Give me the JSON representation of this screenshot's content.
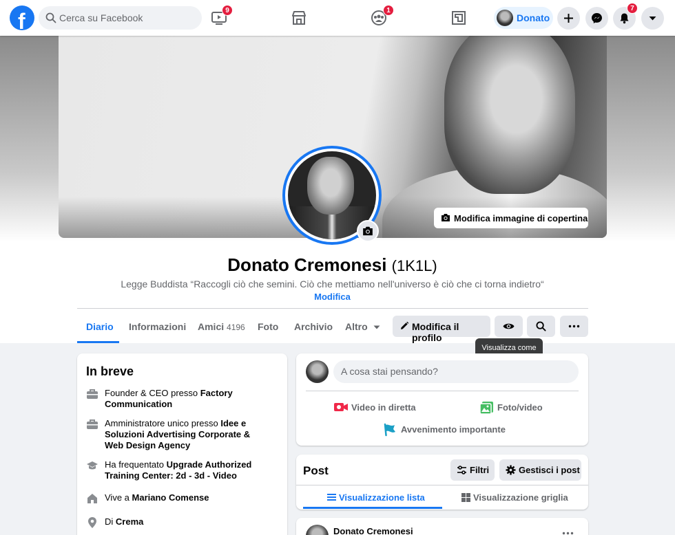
{
  "topbar": {
    "search_placeholder": "Cerca su Facebook",
    "watch_badge": "9",
    "groups_badge": "1",
    "profile_name": "Donato",
    "notifications_badge": "7"
  },
  "cover": {
    "edit_cover_label": "Modifica immagine di copertina"
  },
  "profile": {
    "name": "Donato Cremonesi",
    "alt_name": "(1K1L)",
    "bio": "Legge Buddista “Raccogli ciò che semini. Ciò che mettiamo nell'universo è ciò che ci torna indietro“",
    "bio_edit": "Modifica"
  },
  "tabs": {
    "diario": "Diario",
    "informazioni": "Informazioni",
    "amici": "Amici",
    "amici_count": "4196",
    "foto": "Foto",
    "archivio": "Archivio",
    "altro": "Altro",
    "edit_profile": "Modifica il profilo",
    "view_as_tooltip": "Visualizza come"
  },
  "intro": {
    "title": "In breve",
    "items": [
      {
        "prefix": "Founder & CEO presso ",
        "bold": "Factory Communication",
        "icon": "briefcase-icon"
      },
      {
        "prefix": "Amministratore unico presso ",
        "bold": "Idee e Soluzioni Advertising Corporate & Web Design Agency",
        "icon": "briefcase-icon"
      },
      {
        "prefix": "Ha frequentato ",
        "bold": "Upgrade Authorized Training Center: 2d - 3d - Video",
        "icon": "graduation-cap-icon"
      },
      {
        "prefix": "Vive a ",
        "bold": "Mariano Comense",
        "icon": "home-icon"
      },
      {
        "prefix": "Di ",
        "bold": "Crema",
        "icon": "location-pin-icon"
      }
    ]
  },
  "composer": {
    "placeholder": "A cosa stai pensando?",
    "live_video": "Video in diretta",
    "photo_video": "Foto/video",
    "life_event": "Avvenimento importante"
  },
  "posts": {
    "title": "Post",
    "filters": "Filtri",
    "manage": "Gestisci i post",
    "list_view": "Visualizzazione lista",
    "grid_view": "Visualizzazione griglia"
  },
  "feed": {
    "author": "Donato Cremonesi"
  },
  "colors": {
    "accent": "#1877f2",
    "badge": "#e41e3f",
    "background": "#f0f2f5"
  }
}
